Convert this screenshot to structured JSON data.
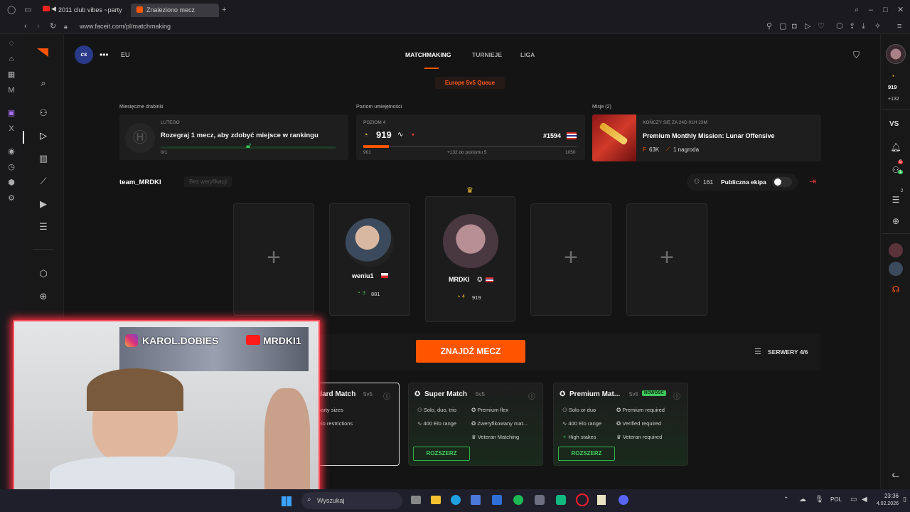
{
  "browser": {
    "tabs": [
      {
        "label": "2011 club vibes ~party",
        "active": false
      },
      {
        "label": "Znaleziono mecz",
        "active": true
      }
    ],
    "url": "www.faceit.com/pl/matchmaking"
  },
  "header": {
    "game_badge": "cs",
    "region": "EU",
    "nav": [
      "MATCHMAKING",
      "TURNIEJE",
      "LIGA"
    ],
    "queue_label": "Europe 5v5 Queue"
  },
  "ladder": {
    "section_title": "Miesięczne drabinki",
    "month": "LUTEGO",
    "text": "Rozegraj 1 mecz, aby zdobyć miejsce w rankingu",
    "progress": "0/1"
  },
  "skill": {
    "section_title": "Poziom umiejętności",
    "level_label": "POZIOM 4",
    "elo": "919",
    "rank": "#1594",
    "min": "901",
    "to_next": "+132 do poziomu 5",
    "max": "1050",
    "progress_fraction": 0.12
  },
  "missions": {
    "section_title": "Misje (2)",
    "timer": "KOŃCZY SIĘ ZA 24D 01H 23M",
    "title": "Premium Monthly Mission: Lunar Offensive",
    "points": "63K",
    "reward": "1 nagroda"
  },
  "team": {
    "name": "team_MRDKI",
    "verification": "Bez weryfikacji",
    "online_count": "161",
    "visibility_label": "Publiczna ekipa"
  },
  "players": [
    {
      "name": "weniu1",
      "level": "3",
      "elo": "881"
    },
    {
      "name": "MRDKI",
      "level": "4",
      "elo": "919"
    }
  ],
  "actions": {
    "find_match": "ZNAJDŹ MECZ",
    "servers": "SERWERY 4/6"
  },
  "modes": [
    {
      "title": "dard Match",
      "format": "5v5",
      "features": [
        "party sizes",
        "Elo restrictions"
      ]
    },
    {
      "title": "Super Match",
      "format": "5v5",
      "features": [
        "Solo, duo, trio",
        "Premium flex",
        "400 Elo range",
        "Zweryfikowany mat...",
        "Veteran Matching"
      ],
      "button": "ROZSZERZ"
    },
    {
      "title": "Premium Mat...",
      "format": "5v5",
      "badge": "NOWOŚĆ",
      "features": [
        "Solo or duo",
        "Premium required",
        "400 Elo range",
        "Verified required",
        "High stakes",
        "Veteran required"
      ],
      "button": "ROZSZERZ"
    }
  ],
  "right_rail": {
    "elo": "919",
    "delta": "+132",
    "vs": "VS",
    "notif_badge": "5",
    "friends_badge": "1",
    "party_badge": "2"
  },
  "webcam": {
    "instagram": "KAROL.DOBIES",
    "youtube": "MRDKI1"
  },
  "taskbar": {
    "search": "Wyszukaj",
    "lang": "POL",
    "time": "23:36",
    "date": "4.02.2026"
  },
  "colors": {
    "accent": "#ff5500",
    "green": "#3ec95c",
    "bg": "#141414"
  }
}
